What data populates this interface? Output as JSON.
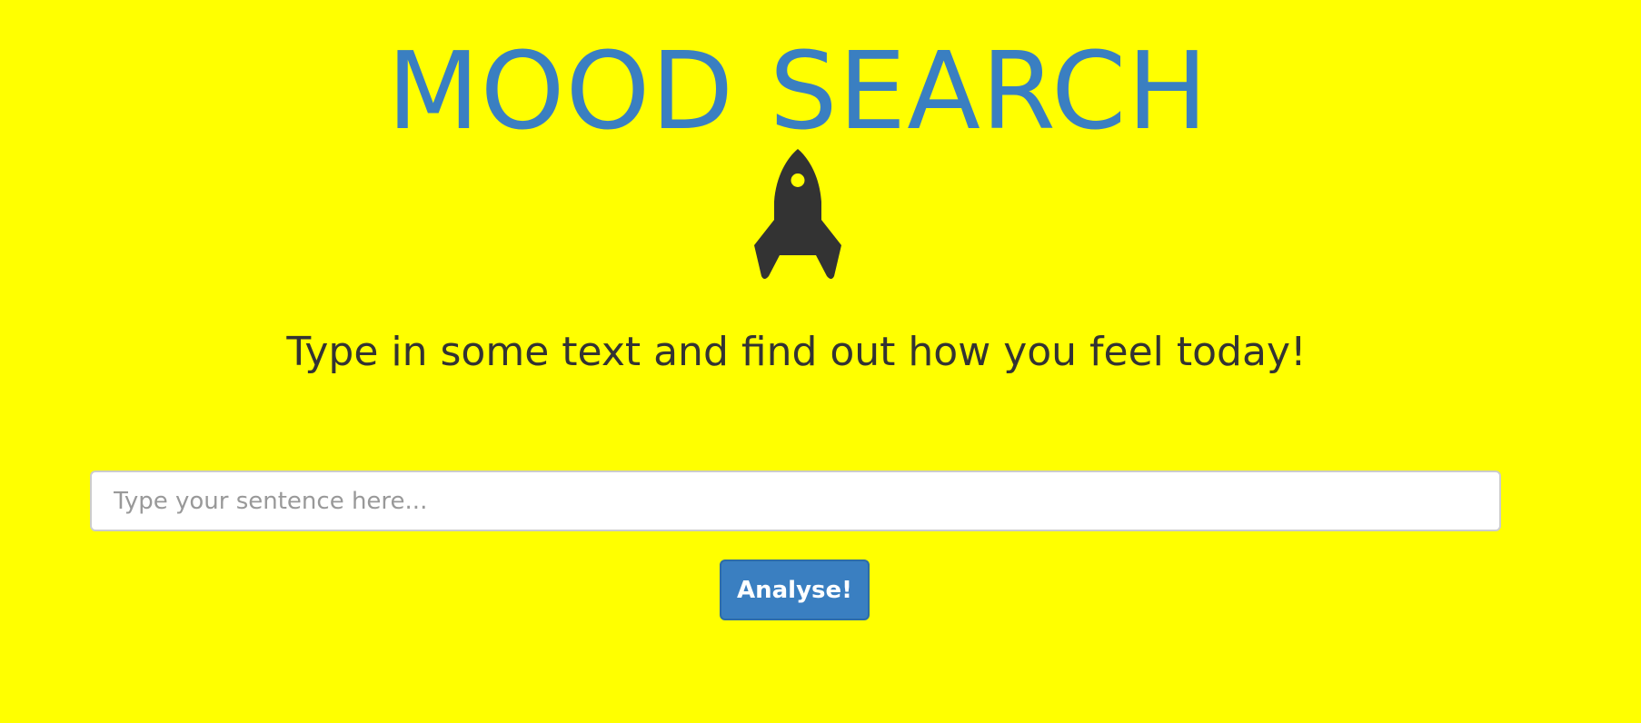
{
  "header": {
    "title": "MOOD SEARCH",
    "icon": "rocket-icon"
  },
  "intro": {
    "subtitle": "Type in some text and find out how you feel today!"
  },
  "search": {
    "value": "",
    "placeholder": "Type your sentence here..."
  },
  "actions": {
    "analyse_label": "Analyse!"
  },
  "colors": {
    "background": "#ffff00",
    "title": "#3a7fc1",
    "text": "#333333",
    "button": "#3a7fc1",
    "button_text": "#ffffff",
    "icon": "#333333"
  }
}
